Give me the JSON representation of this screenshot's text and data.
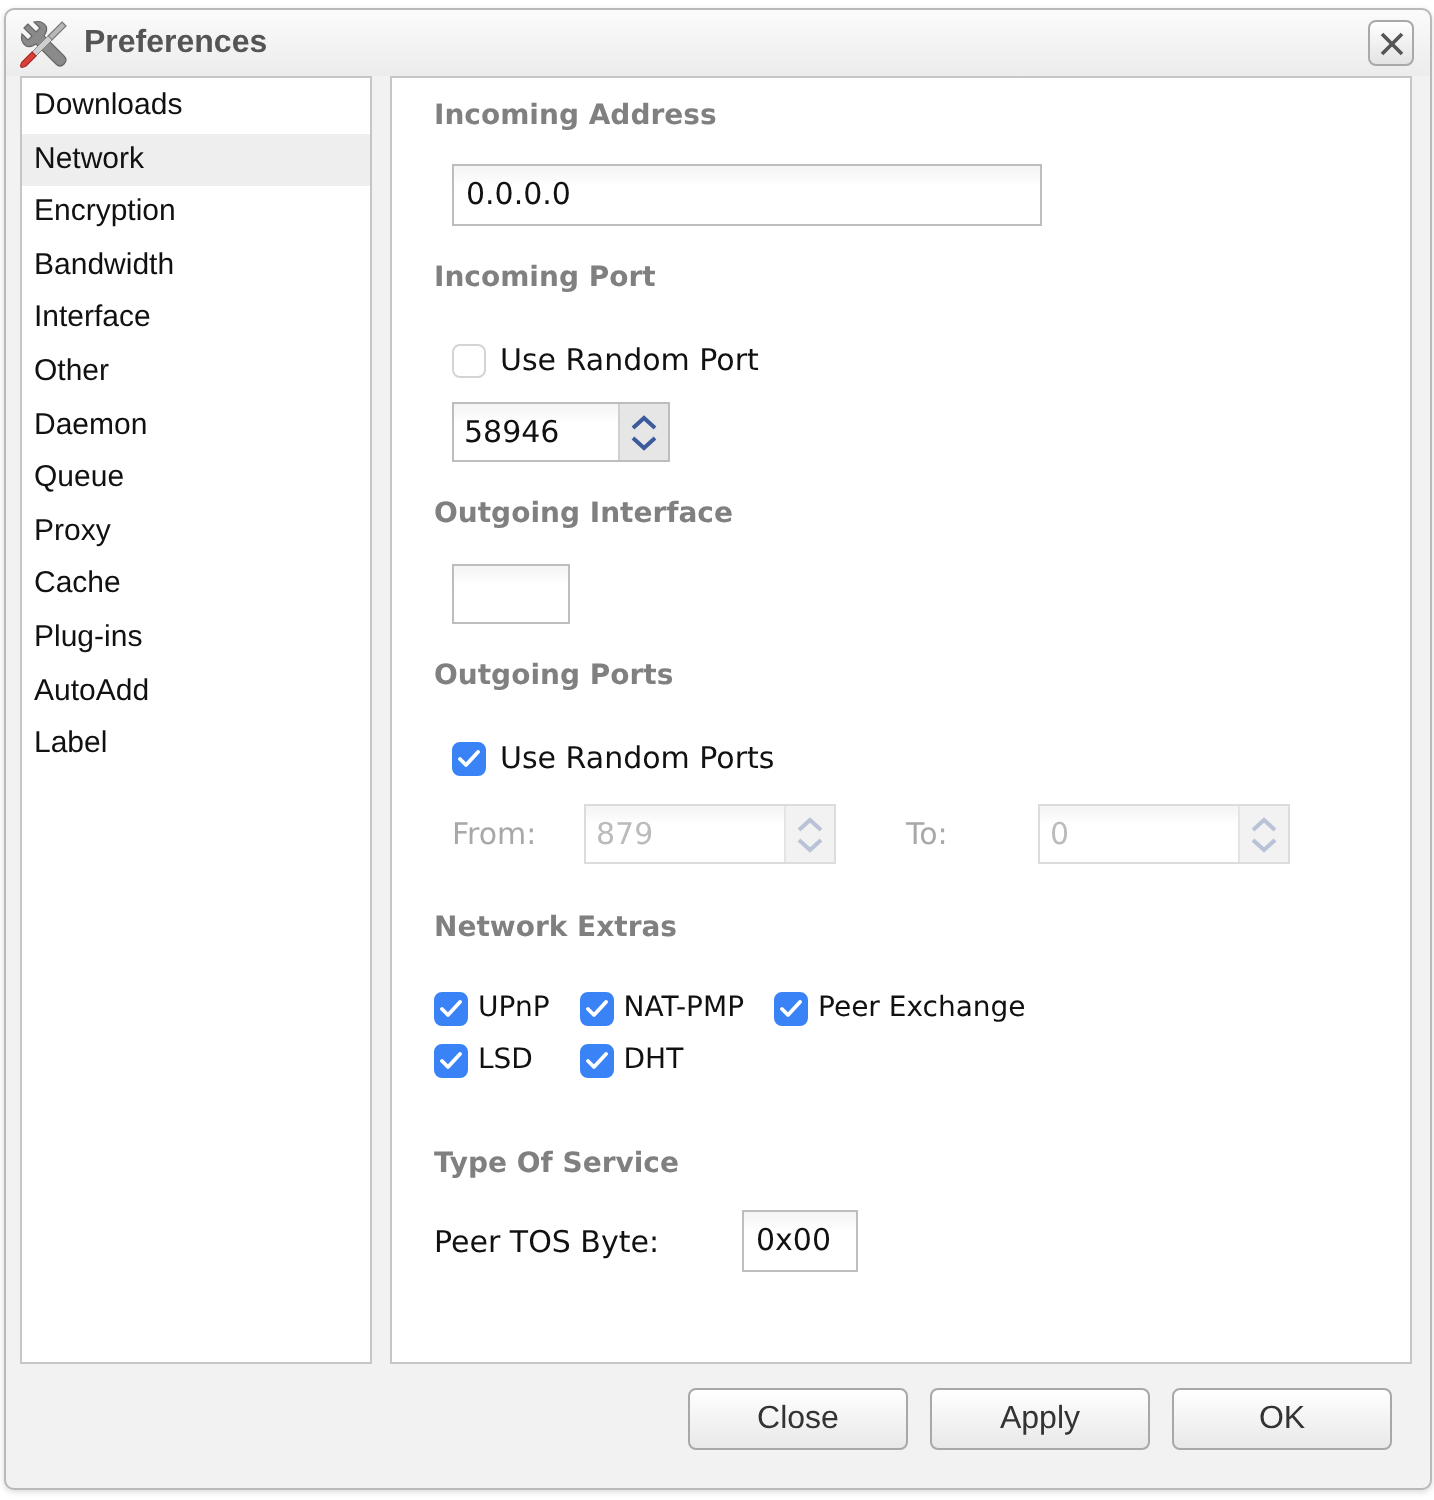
{
  "window": {
    "title": "Preferences"
  },
  "sidebar": {
    "items": [
      {
        "label": "Downloads",
        "selected": false
      },
      {
        "label": "Network",
        "selected": true
      },
      {
        "label": "Encryption",
        "selected": false
      },
      {
        "label": "Bandwidth",
        "selected": false
      },
      {
        "label": "Interface",
        "selected": false
      },
      {
        "label": "Other",
        "selected": false
      },
      {
        "label": "Daemon",
        "selected": false
      },
      {
        "label": "Queue",
        "selected": false
      },
      {
        "label": "Proxy",
        "selected": false
      },
      {
        "label": "Cache",
        "selected": false
      },
      {
        "label": "Plug-ins",
        "selected": false
      },
      {
        "label": "AutoAdd",
        "selected": false
      },
      {
        "label": "Label",
        "selected": false
      }
    ]
  },
  "sections": [
    {
      "heading": "Incoming Address",
      "controls": [
        {
          "kind": "text-field",
          "value": "0.0.0.0"
        }
      ]
    },
    {
      "heading": "Incoming Port",
      "controls": [
        {
          "kind": "checkbox",
          "label": "Use Random Port",
          "checked": false
        },
        {
          "kind": "spinner",
          "value": "58946",
          "disabled": false
        }
      ]
    },
    {
      "heading": "Outgoing Interface",
      "controls": [
        {
          "kind": "short-field"
        }
      ]
    },
    {
      "heading": "Outgoing Ports",
      "controls": [
        {
          "kind": "checkbox",
          "label": "Use Random Ports",
          "checked": true
        },
        {
          "kind": "range",
          "disabled": true,
          "fields": [
            {
              "label": "From:",
              "value": "879"
            },
            {
              "label": "To:",
              "value": "0"
            }
          ]
        }
      ]
    },
    {
      "heading": "Network Extras",
      "controls": [
        {
          "kind": "checkbox-grid",
          "items": [
            {
              "label": "UPnP",
              "checked": true
            },
            {
              "label": "NAT-PMP",
              "checked": true
            },
            {
              "label": "Peer Exchange",
              "checked": true
            },
            {
              "label": "LSD",
              "checked": true
            },
            {
              "label": "DHT",
              "checked": true
            }
          ]
        }
      ]
    },
    {
      "heading": "Type Of Service",
      "controls": [
        {
          "kind": "labeled-field",
          "label": "Peer TOS Byte:",
          "value": "0x00"
        }
      ]
    }
  ],
  "buttons": [
    "Close",
    "Apply",
    "OK"
  ]
}
